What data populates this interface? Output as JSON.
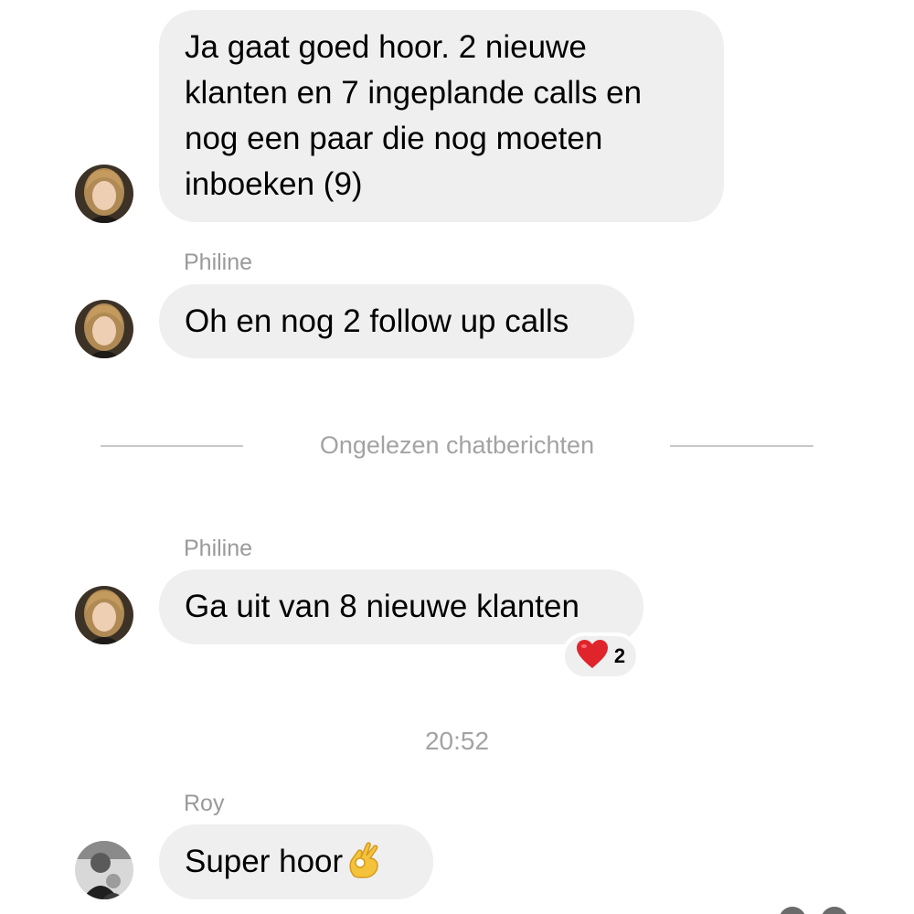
{
  "messages": [
    {
      "sender": "",
      "text": "Ja gaat goed hoor. 2 nieuwe klanten en 7 ingeplande calls en nog een paar die nog moeten inboeken (9)"
    },
    {
      "sender": "Philine",
      "text": "Oh en nog 2 follow up calls"
    },
    {
      "sender": "Philine",
      "text": "Ga uit van 8 nieuwe klanten",
      "reaction": {
        "icon": "red-heart",
        "count": "2"
      }
    },
    {
      "sender": "Roy",
      "text": "Super hoor",
      "emoji": "ok-hand"
    }
  ],
  "divider": {
    "label": "Ongelezen chatberichten"
  },
  "timestamp": "20:52",
  "colors": {
    "bubble": "#efefef",
    "sender": "#9a9a9a",
    "divider": "#c9c9c9",
    "heart": "#e0242c",
    "ok_hand": "#f5c33b"
  }
}
